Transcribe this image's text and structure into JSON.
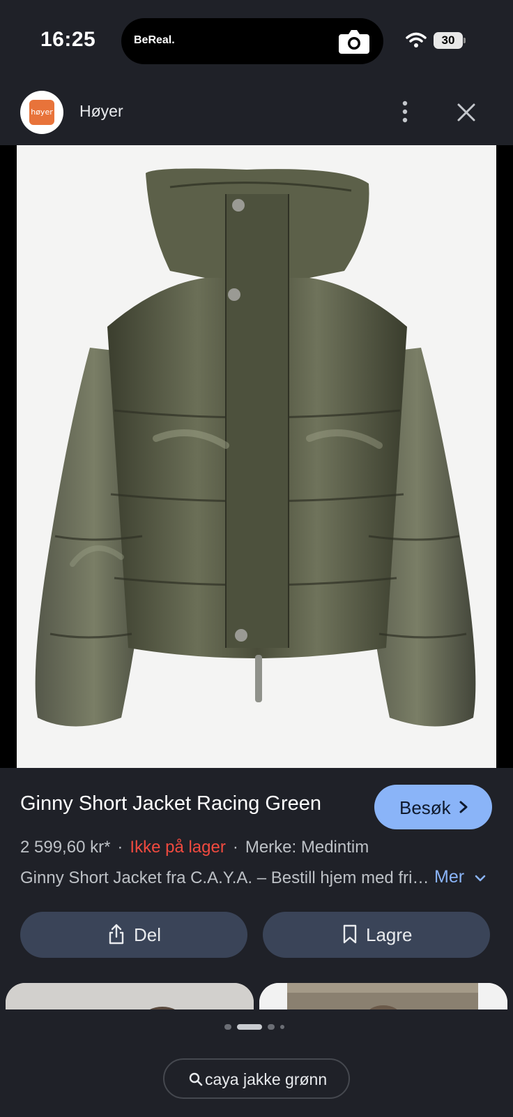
{
  "status_bar": {
    "time": "16:25",
    "island_app": "BeReal.",
    "battery": "30",
    "icons": [
      "camera-icon",
      "wifi-icon",
      "battery-icon"
    ]
  },
  "source": {
    "logo_text": "høyer",
    "name": "Høyer",
    "icons": [
      "more-vertical-icon",
      "close-icon"
    ],
    "logo_color": "#e8733a"
  },
  "product": {
    "title": "Ginny Short Jacket Racing Green",
    "visit_label": "Besøk",
    "price": "2 599,60 kr*",
    "separator": "·",
    "stock": "Ikke på lager",
    "brand": "Merke: Medintim",
    "description": "Ginny Short Jacket fra C.A.Y.A. – Bestill hjem med fri frakt",
    "more_label": "Mer"
  },
  "actions": {
    "share_label": "Del",
    "save_label": "Lagre"
  },
  "pagination": {
    "count": 4,
    "active": 1
  },
  "search": {
    "query": "caya jakke grønn"
  },
  "colors": {
    "background": "#1f2128",
    "accent": "#8ab4f8",
    "out_of_stock": "#f04a3f",
    "button_bg": "#3a4458",
    "jacket": "#4a4d3a"
  }
}
